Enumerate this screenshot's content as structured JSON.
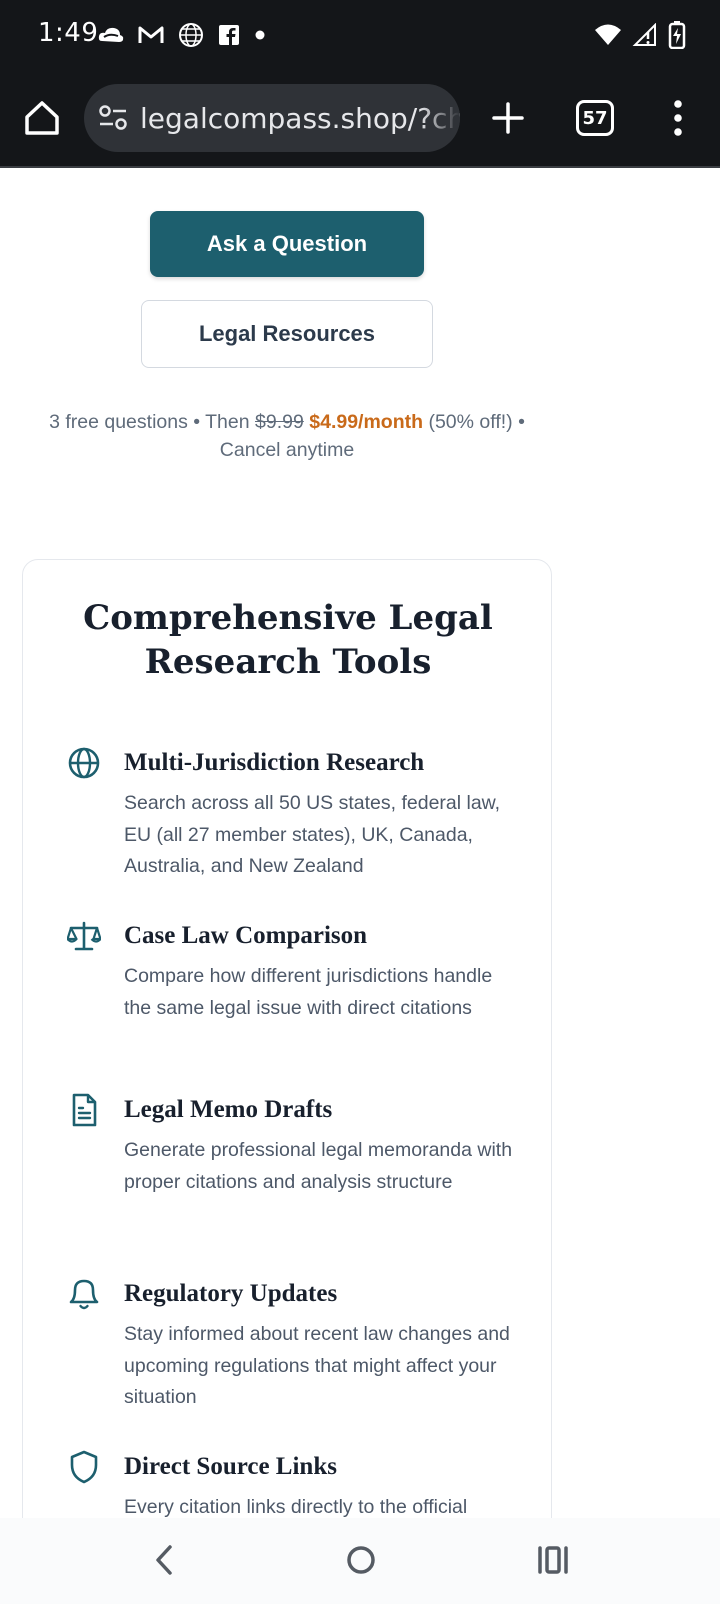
{
  "status_bar": {
    "time": "1:49",
    "left_icons": [
      "cloud-icon",
      "gmail-icon",
      "globe-icon",
      "facebook-icon",
      "dot-icon"
    ],
    "right_icons": [
      "wifi-icon",
      "signal-icon",
      "battery-charging-icon"
    ]
  },
  "browser": {
    "url": "legalcompass.shop/?cha",
    "tab_count": "57"
  },
  "hero": {
    "primary_button": "Ask a Question",
    "secondary_button": "Legal Resources"
  },
  "pricing": {
    "prefix": "3 free questions • Then",
    "old_price": "$9.99",
    "new_price": "$4.99/month",
    "discount": "(50% off!) •",
    "suffix": "Cancel anytime"
  },
  "features_card": {
    "title_line1": "Comprehensive Legal",
    "title_line2": "Research Tools",
    "items": [
      {
        "icon": "globe-icon",
        "title": "Multi-Jurisdiction Research",
        "description": "Search across all 50 US states, federal law, EU (all 27 member states), UK, Canada, Australia, and New Zealand"
      },
      {
        "icon": "scale-icon",
        "title": "Case Law Comparison",
        "description": "Compare how different jurisdictions handle the same legal issue with direct citations"
      },
      {
        "icon": "document-icon",
        "title": "Legal Memo Drafts",
        "description": "Generate professional legal memoranda with proper citations and analysis structure"
      },
      {
        "icon": "bell-icon",
        "title": "Regulatory Updates",
        "description": "Stay informed about recent law changes and upcoming regulations that might affect your situation"
      },
      {
        "icon": "shield-icon",
        "title": "Direct Source Links",
        "description": "Every citation links directly to the official"
      }
    ]
  },
  "colors": {
    "primary": "#1d5f6e",
    "accent_price": "#c96a1a",
    "icon": "#1d5f6e"
  }
}
